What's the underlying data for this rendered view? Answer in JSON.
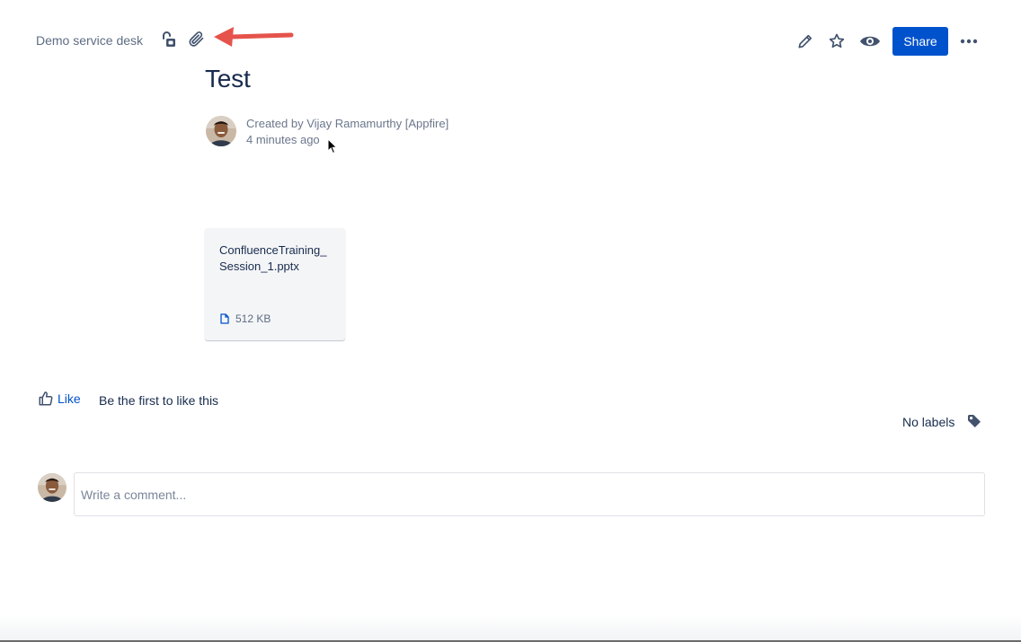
{
  "header": {
    "breadcrumb": "Demo service desk",
    "share_label": "Share"
  },
  "icons": {
    "restrictions": "unlock-icon",
    "attachments": "paperclip-icon",
    "edit": "pencil-icon",
    "star": "star-icon",
    "watch": "eye-icon",
    "more": "more-icon",
    "labels": "tag-icon",
    "like": "thumbs-up-icon",
    "file": "file-icon"
  },
  "page": {
    "title": "Test",
    "byline_created": "Created by Vijay Ramamurthy [Appfire]",
    "byline_time": "4 minutes ago"
  },
  "attachment": {
    "name": "ConfluenceTraining_Session_1.pptx",
    "size": "512 KB"
  },
  "likes": {
    "button_label": "Like",
    "text": "Be the first to like this"
  },
  "labels": {
    "text": "No labels"
  },
  "comment": {
    "placeholder": "Write a comment..."
  },
  "colors": {
    "brand": "#0052cc",
    "text": "#172b4d",
    "subtle": "#5e6c84",
    "annotation_arrow": "#e5534b"
  }
}
